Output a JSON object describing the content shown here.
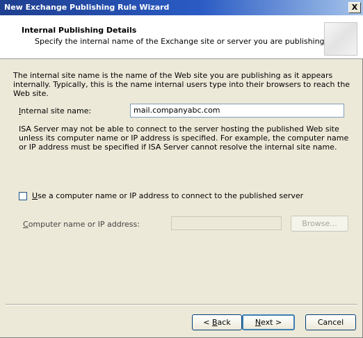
{
  "window": {
    "title": "New Exchange Publishing Rule Wizard",
    "close_glyph": "X"
  },
  "header": {
    "title": "Internal Publishing Details",
    "subtitle": "Specify the internal name of the Exchange site or server you are publishing."
  },
  "intro_text": "The internal site name is the name of the Web site you are publishing as it appears internally. Typically, this is the name internal users type into their browsers to reach the Web site.",
  "internal_site": {
    "label_mnemonic": "I",
    "label_rest": "nternal site name:",
    "value": "mail.companyabc.com"
  },
  "warning_text": "ISA Server may not be able to connect to the server hosting the published Web site unless its computer name or IP address is specified. For example, the computer name or IP address must be specified if ISA Server cannot resolve the internal site name.",
  "use_computer_name": {
    "label_mnemonic": "U",
    "label_rest": "se a computer name or IP address to connect to the published server",
    "checked": false
  },
  "computer_name": {
    "label_mnemonic": "C",
    "label_rest": "omputer name or IP address:",
    "value": ""
  },
  "browse_button": {
    "label_mnemonic": "",
    "label_rest": "Browse..."
  },
  "buttons": {
    "back_prefix": "< ",
    "back_mnemonic": "B",
    "back_rest": "ack",
    "next_mnemonic": "N",
    "next_rest": "ext >",
    "cancel": "Cancel"
  }
}
